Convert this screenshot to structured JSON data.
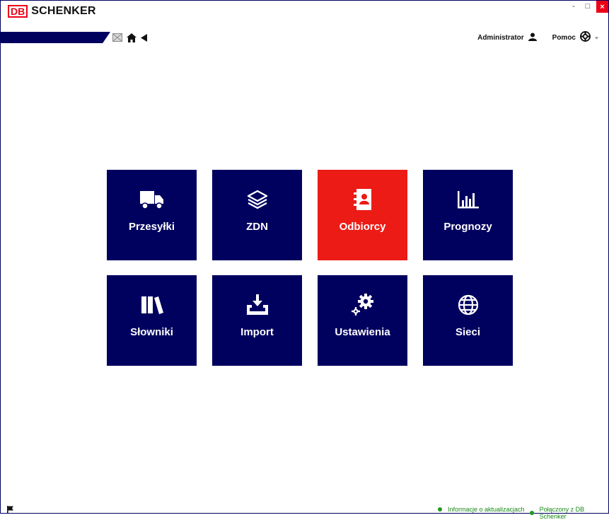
{
  "brand": {
    "db": "DB",
    "name": "SCHENKER"
  },
  "window": {
    "minimize": "-",
    "maximize": "□",
    "close": "×"
  },
  "header": {
    "user": "Administrator",
    "help": "Pomoc"
  },
  "nav": {
    "icons": [
      "mail-icon",
      "home-icon",
      "back-arrow-icon"
    ]
  },
  "tiles": [
    {
      "label": "Przesyłki",
      "icon": "truck-icon"
    },
    {
      "label": "ZDN",
      "icon": "layers-icon"
    },
    {
      "label": "Odbiorcy",
      "icon": "address-book-icon",
      "active": true
    },
    {
      "label": "Prognozy",
      "icon": "bar-chart-icon"
    },
    {
      "label": "Słowniki",
      "icon": "books-icon"
    },
    {
      "label": "Import",
      "icon": "import-icon"
    },
    {
      "label": "Ustawienia",
      "icon": "gears-icon"
    },
    {
      "label": "Sieci",
      "icon": "globe-icon"
    }
  ],
  "footer": {
    "updates": "Informacje o aktualizacjach",
    "connection": "Połączony z DB Schenker"
  },
  "colors": {
    "navy": "#00005f",
    "red": "#ec1b16",
    "status_green": "#1f9a1f"
  }
}
